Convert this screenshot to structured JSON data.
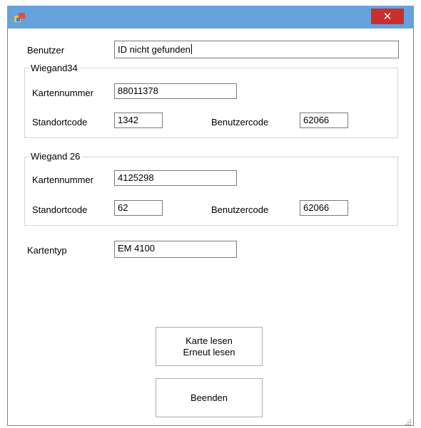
{
  "window": {
    "title": "",
    "close_glyph": "✕",
    "icon": "app-icon"
  },
  "benutzer": {
    "label": "Benutzer",
    "value": "ID nicht gefunden"
  },
  "wiegand34": {
    "title": "Wiegand34",
    "kartennummer_label": "Kartennummer",
    "kartennummer": "88011378",
    "standortcode_label": "Standortcode",
    "standortcode": "1342",
    "benutzercode_label": "Benutzercode",
    "benutzercode": "62066"
  },
  "wiegand26": {
    "title": "Wiegand 26",
    "kartennummer_label": "Kartennummer",
    "kartennummer": "4125298",
    "standortcode_label": "Standortcode",
    "standortcode": "62",
    "benutzercode_label": "Benutzercode",
    "benutzercode": "62066"
  },
  "kartentyp": {
    "label": "Kartentyp",
    "value": "EM 4100"
  },
  "buttons": {
    "read_line1": "Karte lesen",
    "read_line2": "Erneut lesen",
    "exit": "Beenden"
  },
  "colors": {
    "titlebar": "#66a2dc",
    "close": "#c9302c",
    "border": "#4a8fd6"
  }
}
